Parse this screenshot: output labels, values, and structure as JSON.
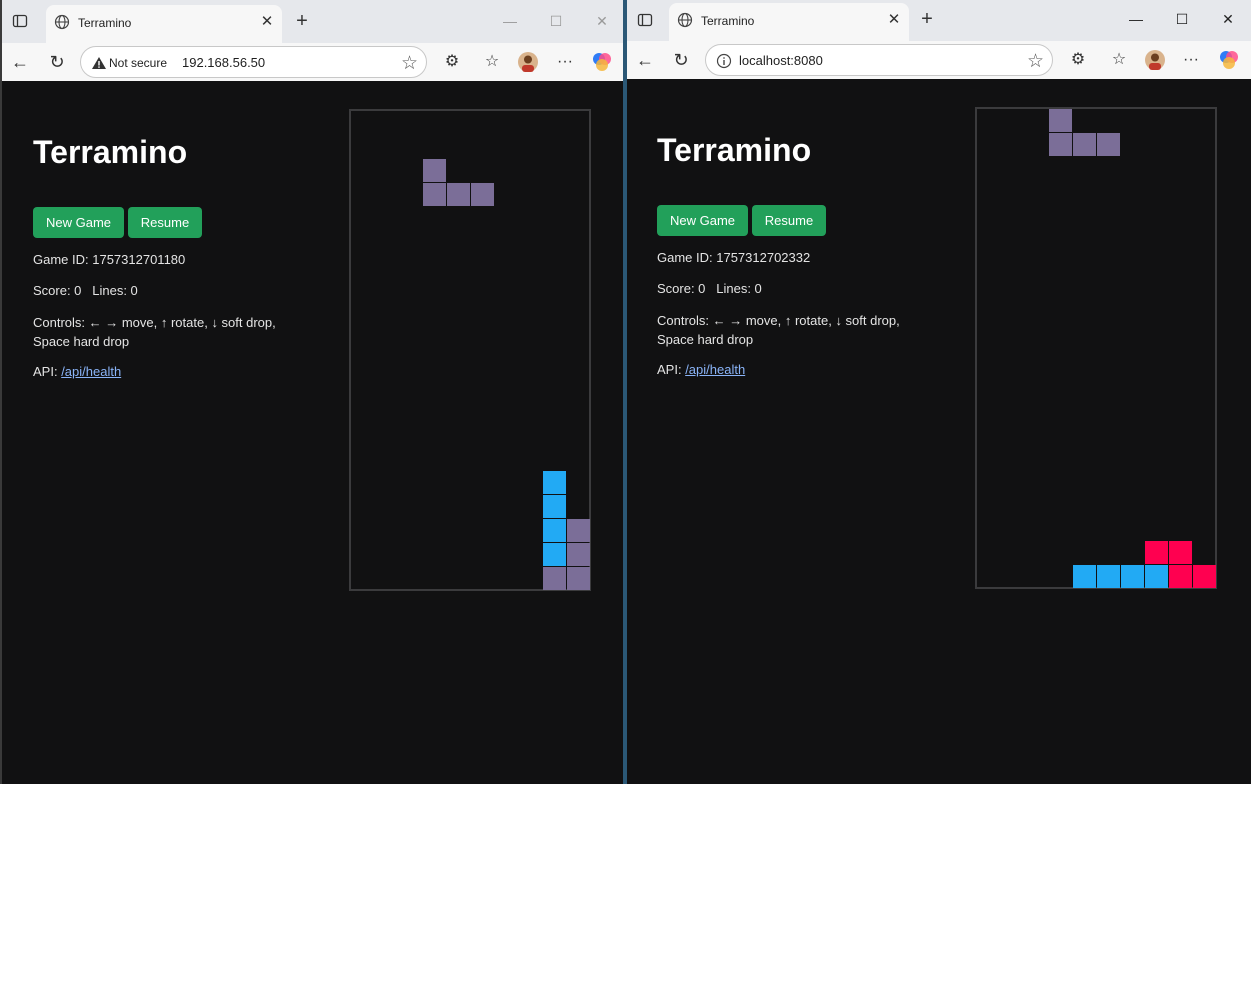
{
  "colors": {
    "purple": "#7b6e98",
    "blue": "#22aaf4",
    "red": "#ff0050",
    "green_button": "#22a05a"
  },
  "windows": [
    {
      "tab_title": "Terramino",
      "not_secure": "Not secure",
      "address": "192.168.56.50",
      "app": {
        "title": "Terramino",
        "new_game_label": "New Game",
        "resume_label": "Resume",
        "game_id_text": "Game ID: 1757312701180",
        "score_text": "Score: 0   Lines: 0",
        "controls_text": "Controls: ← → move, ↑ rotate, ↓ soft drop, Space hard drop",
        "api_label": "API: ",
        "api_link": "/api/health"
      },
      "board": {
        "cols": 10,
        "rows": 20,
        "cells": [
          {
            "col": 3,
            "row": 2,
            "color": "purple"
          },
          {
            "col": 3,
            "row": 3,
            "color": "purple"
          },
          {
            "col": 4,
            "row": 3,
            "color": "purple"
          },
          {
            "col": 5,
            "row": 3,
            "color": "purple"
          },
          {
            "col": 8,
            "row": 15,
            "color": "blue"
          },
          {
            "col": 8,
            "row": 16,
            "color": "blue"
          },
          {
            "col": 8,
            "row": 17,
            "color": "blue"
          },
          {
            "col": 9,
            "row": 17,
            "color": "purple"
          },
          {
            "col": 8,
            "row": 18,
            "color": "blue"
          },
          {
            "col": 9,
            "row": 18,
            "color": "purple"
          },
          {
            "col": 8,
            "row": 19,
            "color": "purple"
          },
          {
            "col": 9,
            "row": 19,
            "color": "purple"
          }
        ]
      }
    },
    {
      "tab_title": "Terramino",
      "address": "localhost:8080",
      "app": {
        "title": "Terramino",
        "new_game_label": "New Game",
        "resume_label": "Resume",
        "game_id_text": "Game ID: 1757312702332",
        "score_text": "Score: 0   Lines: 0",
        "controls_text": "Controls: ← → move, ↑ rotate, ↓ soft drop, Space hard drop",
        "api_label": "API: ",
        "api_link": "/api/health"
      },
      "board": {
        "cols": 10,
        "rows": 20,
        "cells": [
          {
            "col": 3,
            "row": 0,
            "color": "purple"
          },
          {
            "col": 3,
            "row": 1,
            "color": "purple"
          },
          {
            "col": 4,
            "row": 1,
            "color": "purple"
          },
          {
            "col": 5,
            "row": 1,
            "color": "purple"
          },
          {
            "col": 7,
            "row": 18,
            "color": "red"
          },
          {
            "col": 8,
            "row": 18,
            "color": "red"
          },
          {
            "col": 4,
            "row": 19,
            "color": "blue"
          },
          {
            "col": 5,
            "row": 19,
            "color": "blue"
          },
          {
            "col": 6,
            "row": 19,
            "color": "blue"
          },
          {
            "col": 7,
            "row": 19,
            "color": "blue"
          },
          {
            "col": 8,
            "row": 19,
            "color": "red"
          },
          {
            "col": 9,
            "row": 19,
            "color": "red"
          }
        ]
      }
    }
  ]
}
